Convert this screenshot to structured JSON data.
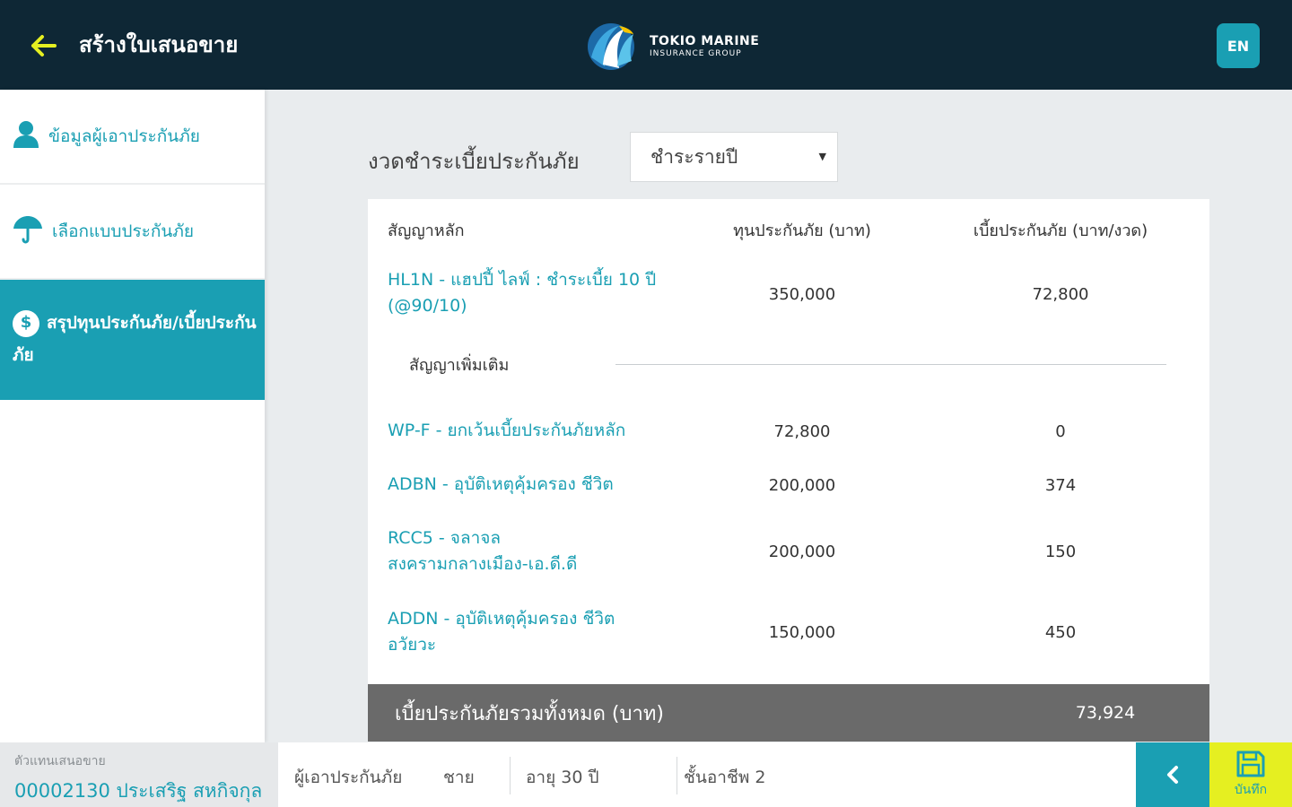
{
  "header": {
    "title": "สร้างใบเสนอขาย",
    "logo_line1": "TOKIO MARINE",
    "logo_line2": "INSURANCE GROUP",
    "lang_button": "EN"
  },
  "sidebar": {
    "items": [
      {
        "label": "ข้อมูลผู้เอาประกันภัย",
        "icon": "person-icon"
      },
      {
        "label": "เลือกแบบประกันภัย",
        "icon": "umbrella-icon"
      },
      {
        "label": "สรุปทุนประกันภัย/เบี้ยประกันภัย",
        "icon": "dollar-icon",
        "active": true
      }
    ]
  },
  "payment": {
    "label": "งวดชำระเบี้ยประกันภัย",
    "selected": "ชำระรายปี"
  },
  "table": {
    "headers": [
      "สัญญาหลัก",
      "ทุนประกันภัย (บาท)",
      "เบี้ยประกันภัย (บาท/งวด)"
    ],
    "main": {
      "name": "HL1N - แฮปปี้ ไลฟ์ : ชำระเบี้ย 10 ปี (@90/10)",
      "sum_insured": "350,000",
      "premium": "72,800"
    },
    "rider_label": "สัญญาเพิ่มเติม",
    "riders": [
      {
        "name": "WP-F - ยกเว้นเบี้ยประกันภัยหลัก",
        "sum_insured": "72,800",
        "premium": "0"
      },
      {
        "name": "ADBN - อุบัติเหตุคุ้มครอง ชีวิต",
        "sum_insured": "200,000",
        "premium": "374"
      },
      {
        "name": "RCC5 - จลาจล สงครามกลางเมือง-เอ.ดี.ดี",
        "sum_insured": "200,000",
        "premium": "150"
      },
      {
        "name": "ADDN - อุบัติเหตุคุ้มครอง ชีวิต อวัยวะ",
        "sum_insured": "150,000",
        "premium": "450"
      }
    ],
    "total_label": "เบี้ยประกันภัยรวมทั้งหมด (บาท)",
    "total_value": "73,924"
  },
  "footer": {
    "agent_title": "ตัวแทนเสนอขาย",
    "agent_name": "00002130 ประเสริฐ สหกิจกุล",
    "insured_label": "ผู้เอาประกันภัย",
    "gender": "ชาย",
    "age": "อายุ 30 ปี",
    "occupation": "ชั้นอาชีพ 2",
    "save_label": "บันทึก"
  },
  "colors": {
    "header_bg": "#0e2735",
    "accent": "#1a9fb3",
    "arrow": "#e5ef21",
    "save_bg": "#e5ef21",
    "total_bg": "#6a6a6a"
  }
}
